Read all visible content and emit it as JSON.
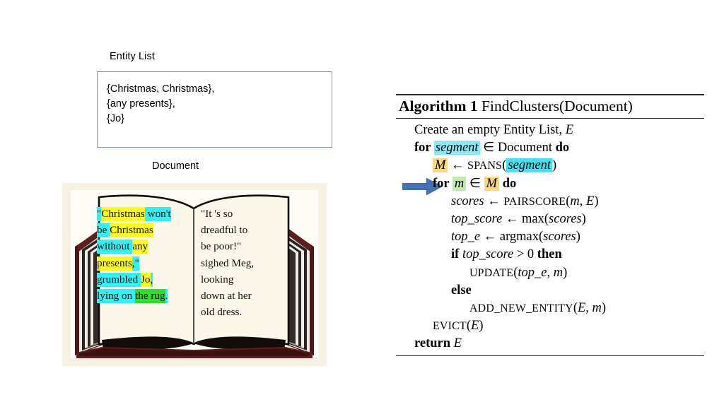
{
  "left_panel": {
    "entity_list_label": "Entity List",
    "entity_list_items": [
      "{Christmas, Christmas},",
      "{any presents},",
      "{Jo}"
    ],
    "document_label": "Document",
    "book": {
      "left_page_lines": [
        [
          {
            "t": "\"",
            "h": "cyan"
          },
          {
            "t": "Christmas",
            "h": "yellow"
          },
          {
            "t": " ",
            "h": "cyan"
          },
          {
            "t": "won't",
            "h": "cyan"
          }
        ],
        [
          {
            "t": "be ",
            "h": "cyan"
          },
          {
            "t": "Christmas",
            "h": "yellow"
          },
          {
            "t": " ",
            "h": "cyan"
          }
        ],
        [
          {
            "t": "without ",
            "h": "cyan"
          },
          {
            "t": "any",
            "h": "yellow"
          }
        ],
        [
          {
            "t": "presents",
            "h": "yellow"
          },
          {
            "t": ",\"",
            "h": "cyan"
          }
        ],
        [
          {
            "t": "grumbled ",
            "h": "cyan"
          },
          {
            "t": "Jo",
            "h": "yellow"
          },
          {
            "t": ",",
            "h": "cyan"
          }
        ],
        [
          {
            "t": "lying on ",
            "h": "cyan"
          },
          {
            "t": "the rug",
            "h": "green"
          },
          {
            "t": ".",
            "h": "cyan"
          }
        ]
      ],
      "right_page_lines": [
        "\"It 's so",
        "dreadful to",
        "be poor!\"",
        "sighed Meg,",
        "looking",
        "down at her",
        "old dress."
      ]
    }
  },
  "algorithm": {
    "title_bold": "Algorithm 1",
    "title_rest": "FindClusters(Document)",
    "lines": [
      {
        "indent": 1,
        "parts": [
          {
            "t": "Create an empty Entity List, "
          },
          {
            "t": "E",
            "s": "italic"
          }
        ]
      },
      {
        "indent": 1,
        "parts": [
          {
            "t": "for ",
            "s": "bold"
          },
          {
            "t": "segment",
            "s": "italic",
            "h": "cyan"
          },
          {
            "t": " ∈ Document "
          },
          {
            "t": "do",
            "s": "bold"
          }
        ]
      },
      {
        "indent": 2,
        "parts": [
          {
            "t": "M",
            "s": "italic",
            "h": "amber"
          },
          {
            "t": " ← "
          },
          {
            "t": "Spans",
            "s": "smallcaps"
          },
          {
            "t": "("
          },
          {
            "t": "segment",
            "s": "italic",
            "h": "cyan2"
          },
          {
            "t": ")"
          }
        ]
      },
      {
        "indent": 2,
        "parts": [
          {
            "t": "for ",
            "s": "bold"
          },
          {
            "t": "m",
            "s": "italic",
            "h": "green"
          },
          {
            "t": " ∈ "
          },
          {
            "t": "M",
            "s": "italic",
            "h": "amber"
          },
          {
            "t": " do",
            "s": "bold"
          }
        ]
      },
      {
        "indent": 3,
        "parts": [
          {
            "t": "scores",
            "s": "italic"
          },
          {
            "t": " ← "
          },
          {
            "t": "PairScore",
            "s": "smallcaps"
          },
          {
            "t": "("
          },
          {
            "t": "m",
            "s": "italic"
          },
          {
            "t": ", "
          },
          {
            "t": "E",
            "s": "italic"
          },
          {
            "t": ")"
          }
        ]
      },
      {
        "indent": 3,
        "parts": [
          {
            "t": "top_score",
            "s": "italic"
          },
          {
            "t": " ← max("
          },
          {
            "t": "scores",
            "s": "italic"
          },
          {
            "t": ")"
          }
        ]
      },
      {
        "indent": 3,
        "parts": [
          {
            "t": "top_e",
            "s": "italic"
          },
          {
            "t": " ← argmax("
          },
          {
            "t": "scores",
            "s": "italic"
          },
          {
            "t": ")"
          }
        ]
      },
      {
        "indent": 3,
        "parts": [
          {
            "t": "if ",
            "s": "bold"
          },
          {
            "t": "top_score",
            "s": "italic"
          },
          {
            "t": " > 0 "
          },
          {
            "t": "then",
            "s": "bold"
          }
        ]
      },
      {
        "indent": 4,
        "parts": [
          {
            "t": "Update",
            "s": "smallcaps"
          },
          {
            "t": "("
          },
          {
            "t": "top_e",
            "s": "italic"
          },
          {
            "t": ", "
          },
          {
            "t": "m",
            "s": "italic"
          },
          {
            "t": ")"
          }
        ]
      },
      {
        "indent": 3,
        "parts": [
          {
            "t": "else",
            "s": "bold"
          }
        ]
      },
      {
        "indent": 4,
        "parts": [
          {
            "t": "Add_new_entity",
            "s": "smallcaps"
          },
          {
            "t": "("
          },
          {
            "t": "E",
            "s": "italic"
          },
          {
            "t": ", "
          },
          {
            "t": "m",
            "s": "italic"
          },
          {
            "t": ")"
          }
        ]
      },
      {
        "indent": 2,
        "parts": [
          {
            "t": "Evict",
            "s": "smallcaps"
          },
          {
            "t": "("
          },
          {
            "t": "E",
            "s": "italic"
          },
          {
            "t": ")"
          }
        ]
      },
      {
        "indent": 1,
        "parts": [
          {
            "t": "return ",
            "s": "bold"
          },
          {
            "t": "E",
            "s": "italic"
          }
        ]
      }
    ],
    "highlight_line_index": 3
  },
  "colors": {
    "highlight_cyan": "#2ff0f5",
    "highlight_yellow": "#fcfa18",
    "highlight_green": "#2bdf2b",
    "alg_cyan": "#8ce8f5",
    "alg_cyan_bright": "#3fe3f2",
    "alg_amber": "#fbd87e",
    "alg_green": "#bfe8ad",
    "arrow_blue": "#4472b8",
    "box_border": "#7e93ae",
    "book_background": "#f6f1e2",
    "page_paper": "#fbf8ea",
    "book_cover": "#5c1f1f"
  },
  "icons": {
    "pointer_arrow": "right-arrow-icon"
  }
}
